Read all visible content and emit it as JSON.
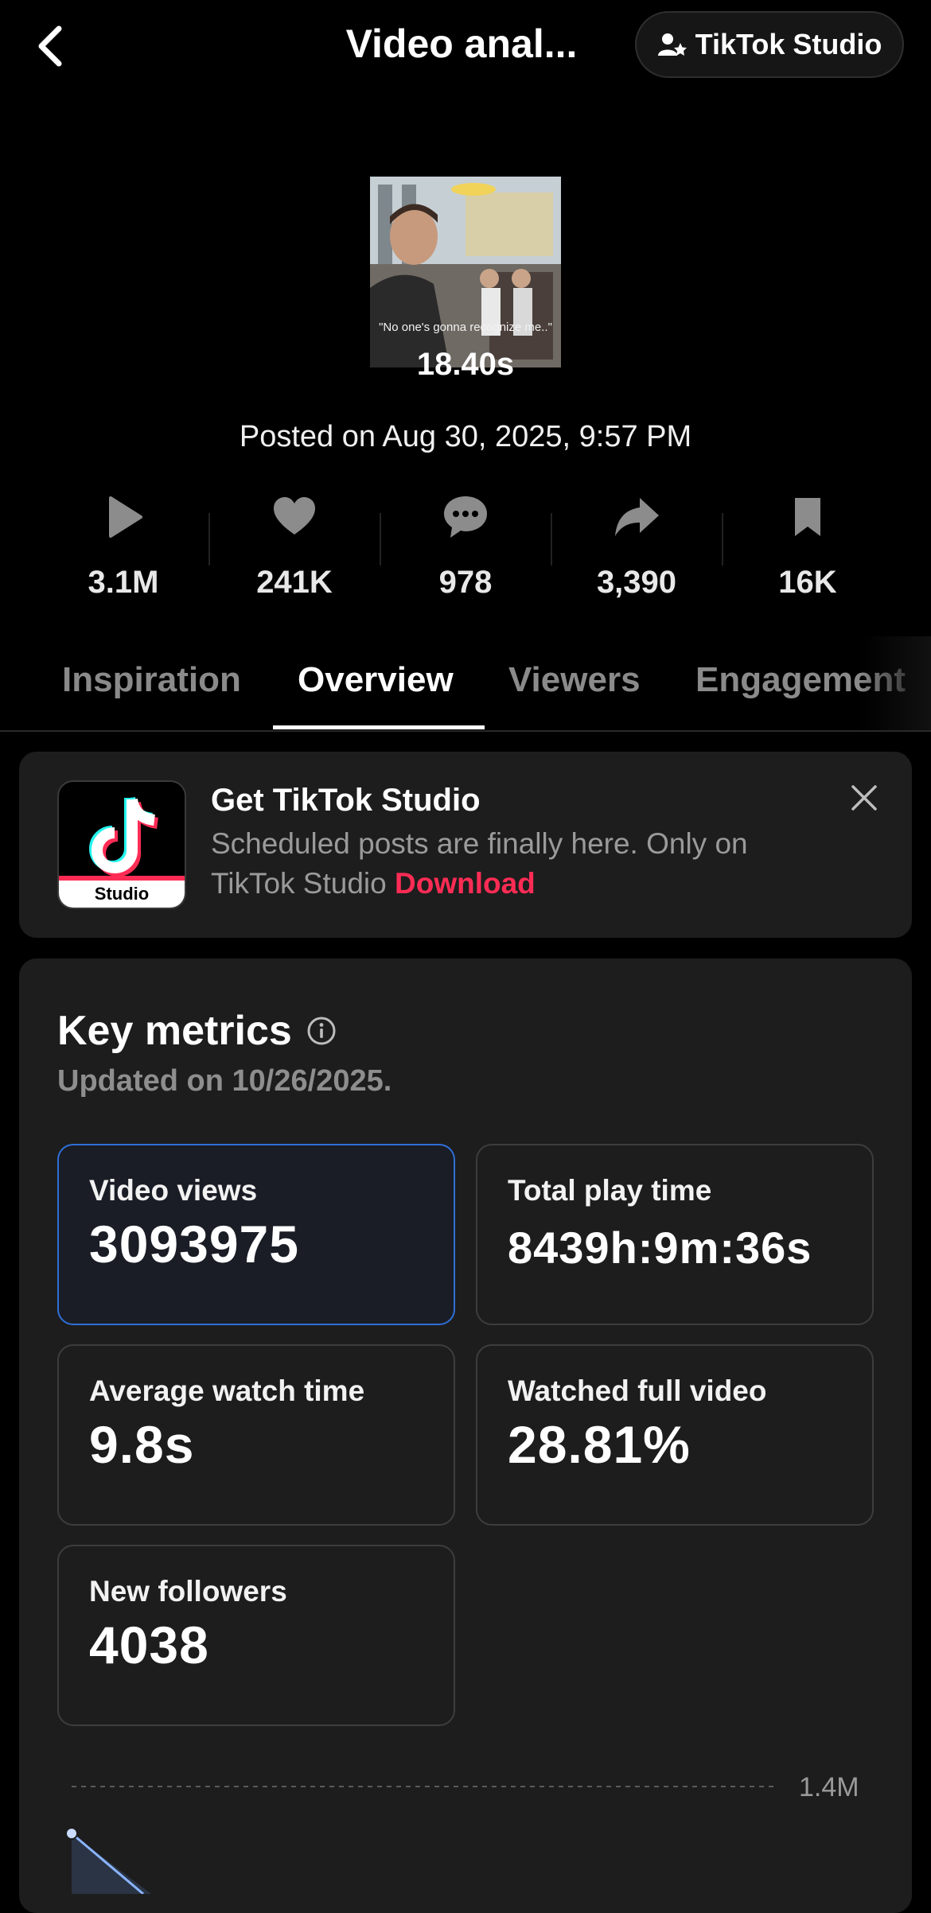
{
  "header": {
    "title": "Video anal...",
    "studio_button": "TikTok Studio"
  },
  "video": {
    "caption": "\"No one's gonna recognize me..\"",
    "duration": "18.40s",
    "posted": "Posted on Aug 30, 2025, 9:57 PM"
  },
  "stats": {
    "views": "3.1M",
    "likes": "241K",
    "comments": "978",
    "shares": "3,390",
    "saves": "16K"
  },
  "tabs": [
    "Inspiration",
    "Overview",
    "Viewers",
    "Engagement"
  ],
  "active_tab": "Overview",
  "promo": {
    "icon_label": "Studio",
    "title": "Get TikTok Studio",
    "text": "Scheduled posts are finally here. Only on TikTok Studio",
    "link": "Download"
  },
  "key_metrics": {
    "title": "Key metrics",
    "updated": "Updated on 10/26/2025.",
    "items": [
      {
        "label": "Video views",
        "value": "3093975"
      },
      {
        "label": "Total play time",
        "value": "8439h:9m:36s"
      },
      {
        "label": "Average watch time",
        "value": "9.8s"
      },
      {
        "label": "Watched full video",
        "value": "28.81%"
      },
      {
        "label": "New followers",
        "value": "4038"
      }
    ]
  },
  "chart": {
    "y_max_label": "1.4M",
    "accent": "#8ab4ff"
  },
  "colors": {
    "accent_red": "#fe2c55",
    "selected_border": "#2f6fd6",
    "card_bg": "#1d1d1d"
  }
}
